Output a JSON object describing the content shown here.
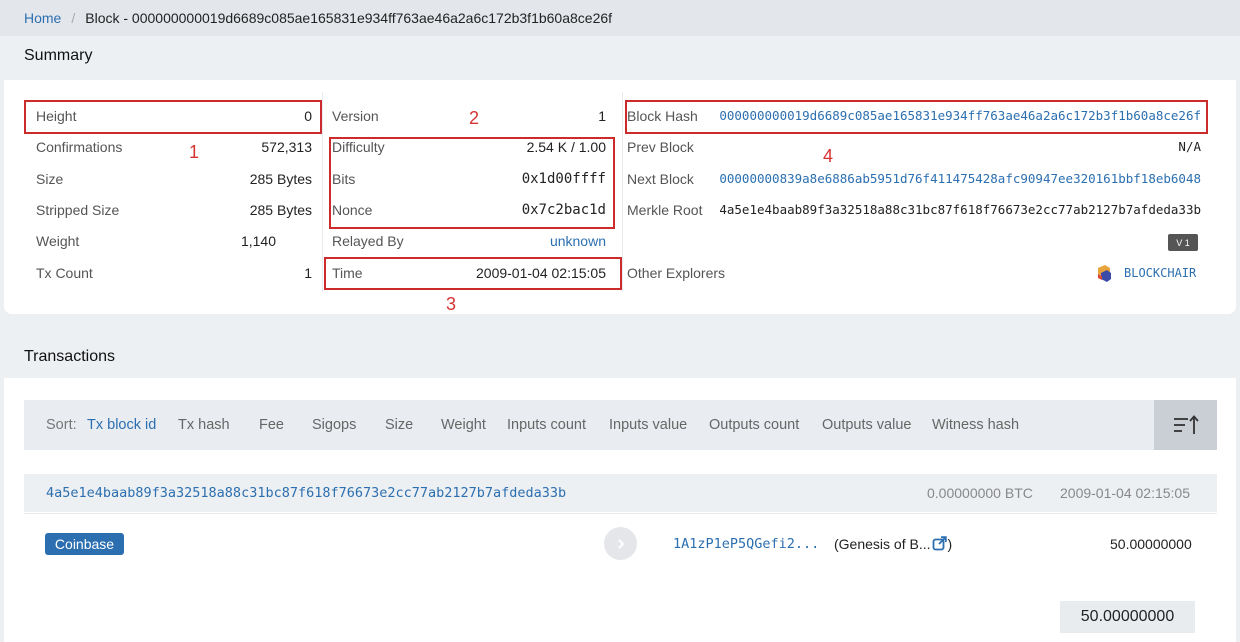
{
  "breadcrumb": {
    "home": "Home",
    "current": "Block - 000000000019d6689c085ae165831e934ff763ae46a2a6c172b3f1b60a8ce26f"
  },
  "summary": {
    "title": "Summary",
    "col1": [
      {
        "key": "Height",
        "value": "0"
      },
      {
        "key": "Confirmations",
        "value": "572,313"
      },
      {
        "key": "Size",
        "value": "285 Bytes"
      },
      {
        "key": "Stripped Size",
        "value": "285 Bytes"
      },
      {
        "key": "Weight",
        "value": "1,140"
      },
      {
        "key": "Tx Count",
        "value": "1"
      }
    ],
    "col2": [
      {
        "key": "Version",
        "value": "1"
      },
      {
        "key": "Difficulty",
        "value": "2.54 K / 1.00"
      },
      {
        "key": "Bits",
        "value": "0x1d00ffff"
      },
      {
        "key": "Nonce",
        "value": "0x7c2bac1d"
      },
      {
        "key": "Relayed By",
        "value": "unknown"
      },
      {
        "key": "Time",
        "value": "2009-01-04 02:15:05"
      }
    ],
    "col3": [
      {
        "key": "Block Hash",
        "value": "000000000019d6689c085ae165831e934ff763ae46a2a6c172b3f1b60a8ce26f"
      },
      {
        "key": "Prev Block",
        "value": "N/A"
      },
      {
        "key": "Next Block",
        "value": "00000000839a8e6886ab5951d76f411475428afc90947ee320161bbf18eb6048"
      },
      {
        "key": "Merkle Root",
        "value": "4a5e1e4baab89f3a32518a88c31bc87f618f76673e2cc77ab2127b7afdeda33b"
      },
      {
        "key": "Other Explorers",
        "value": ""
      }
    ],
    "version_badge": "V 1",
    "explorer": "BLOCKCHAIR"
  },
  "annotations": [
    "1",
    "2",
    "3",
    "4"
  ],
  "transactions": {
    "title": "Transactions",
    "sort_label": "Sort:",
    "sort_options": [
      "Tx block id",
      "Tx hash",
      "Fee",
      "Sigops",
      "Size",
      "Weight",
      "Inputs count",
      "Inputs value",
      "Outputs count",
      "Outputs value",
      "Witness hash"
    ],
    "tx": {
      "hash": "4a5e1e4baab89f3a32518a88c31bc87f618f76673e2cc77ab2127b7afdeda33b",
      "fee": "0.00000000 BTC",
      "time": "2009-01-04 02:15:05",
      "input": "Coinbase",
      "output_address": "1A1zP1eP5QGefi2...",
      "output_label_open": "(Genesis of B...",
      "output_label_close": ")",
      "output_value": "50.00000000",
      "total": "50.00000000"
    }
  },
  "colors": {
    "link": "#2c6fb0",
    "annotation": "#cc2b2b"
  }
}
